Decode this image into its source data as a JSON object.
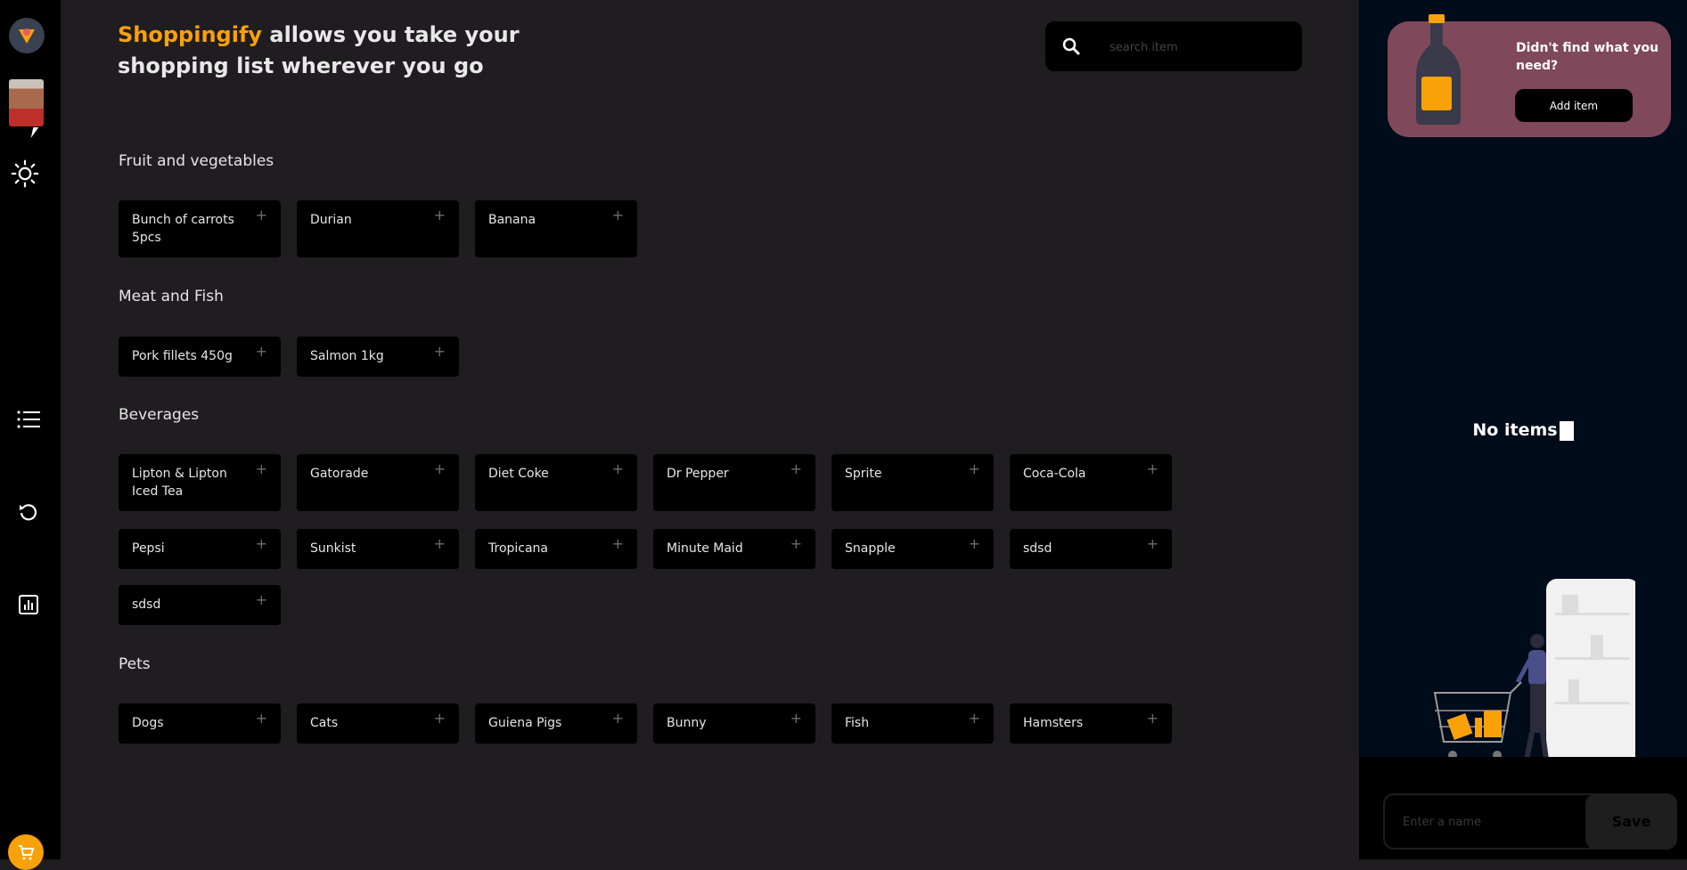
{
  "brand": "Shoppingify",
  "headline_rest_1": " allows you take your",
  "headline_line_2": "shopping list wherever you go",
  "search": {
    "placeholder": "search item"
  },
  "categories": [
    {
      "title": "Fruit and vegetables",
      "items": [
        "Bunch of carrots 5pcs",
        "Durian",
        "Banana"
      ]
    },
    {
      "title": "Meat and Fish",
      "items": [
        "Pork fillets 450g",
        "Salmon 1kg"
      ]
    },
    {
      "title": "Beverages",
      "items": [
        "Lipton & Lipton Iced Tea",
        "Gatorade",
        "Diet Coke",
        "Dr Pepper",
        "Sprite",
        "Coca-Cola",
        "Pepsi",
        "Sunkist",
        "Tropicana",
        "Minute Maid",
        "Snapple",
        "sdsd",
        "sdsd"
      ]
    },
    {
      "title": "Pets",
      "items": [
        "Dogs",
        "Cats",
        "Guiena Pigs",
        "Bunny",
        "Fish",
        "Hamsters"
      ]
    }
  ],
  "plus_symbol": "+",
  "sidebar_card": {
    "text": "Didn't find what you need?",
    "button": "Add item"
  },
  "list": {
    "empty_text": "No items"
  },
  "save_form": {
    "placeholder": "Enter a name",
    "button": "Save"
  },
  "colors": {
    "accent": "#f9a109",
    "card": "#80485b",
    "panel": "#000c1a"
  }
}
